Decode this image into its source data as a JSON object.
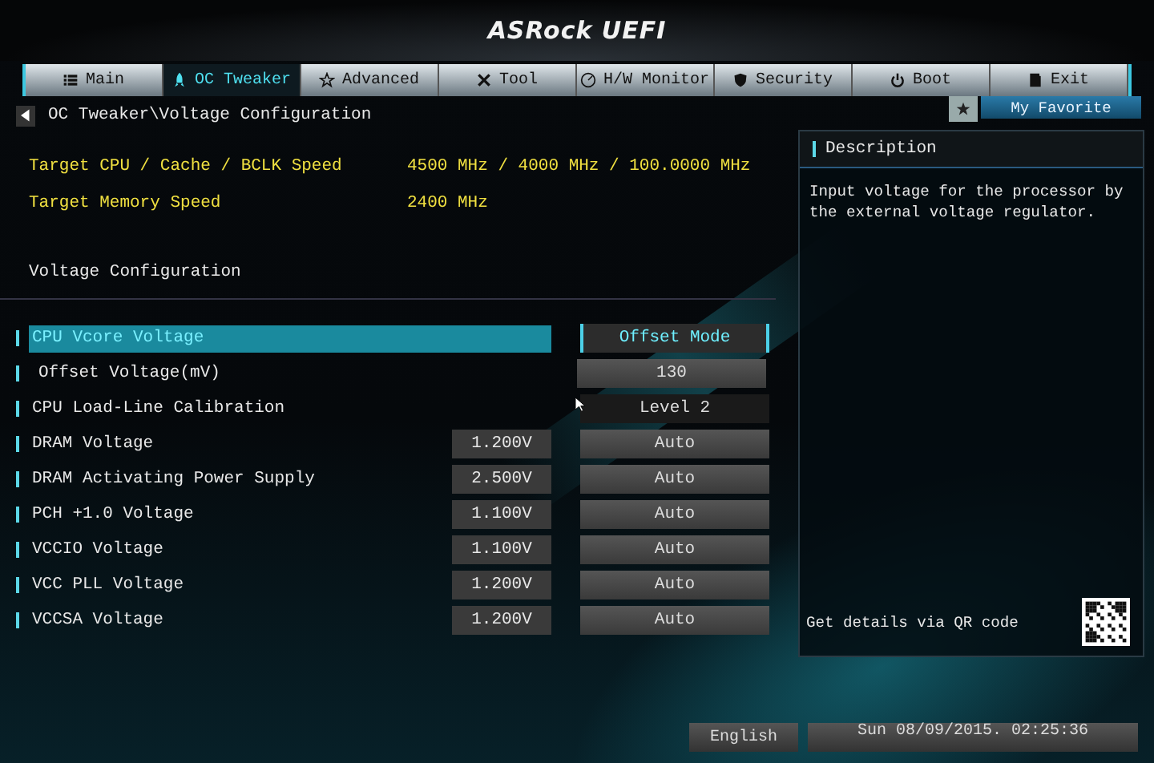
{
  "logo": "ASRock UEFI",
  "tabs": [
    {
      "label": "Main",
      "selected": false
    },
    {
      "label": "OC Tweaker",
      "selected": true
    },
    {
      "label": "Advanced",
      "selected": false
    },
    {
      "label": "Tool",
      "selected": false
    },
    {
      "label": "H/W Monitor",
      "selected": false
    },
    {
      "label": "Security",
      "selected": false
    },
    {
      "label": "Boot",
      "selected": false
    },
    {
      "label": "Exit",
      "selected": false
    }
  ],
  "favorite": {
    "label": "My Favorite"
  },
  "breadcrumb": "OC Tweaker\\Voltage Configuration",
  "info": [
    {
      "label": "Target CPU / Cache / BCLK Speed",
      "value": "4500 MHz / 4000 MHz / 100.0000 MHz"
    },
    {
      "label": "Target Memory Speed",
      "value": "2400 MHz"
    }
  ],
  "section_title": "Voltage Configuration",
  "settings": [
    {
      "label": "CPU Vcore Voltage",
      "value": "Offset Mode",
      "selected": true,
      "children": [
        {
          "label": "Offset Voltage(mV)",
          "value": "130",
          "selected": false
        }
      ]
    },
    {
      "label": "CPU Load-Line Calibration",
      "value": "Level 2",
      "selected": false,
      "hovered": true
    },
    {
      "label": "DRAM Voltage",
      "reading": "1.200V",
      "value": "Auto",
      "selected": false
    },
    {
      "label": "DRAM Activating Power Supply",
      "reading": "2.500V",
      "value": "Auto",
      "selected": false
    },
    {
      "label": "PCH +1.0 Voltage",
      "reading": "1.100V",
      "value": "Auto",
      "selected": false
    },
    {
      "label": "VCCIO Voltage",
      "reading": "1.100V",
      "value": "Auto",
      "selected": false
    },
    {
      "label": "VCC PLL Voltage",
      "reading": "1.200V",
      "value": "Auto",
      "selected": false
    },
    {
      "label": "VCCSA Voltage",
      "reading": "1.200V",
      "value": "Auto",
      "selected": false
    }
  ],
  "description": {
    "title": "Description",
    "text": "Input voltage for the processor by the external voltage regulator.",
    "qr_label": "Get details via QR code"
  },
  "status_bar": {
    "language": "English",
    "datetime": "Sun 08/09/2015. 02:25:36"
  }
}
